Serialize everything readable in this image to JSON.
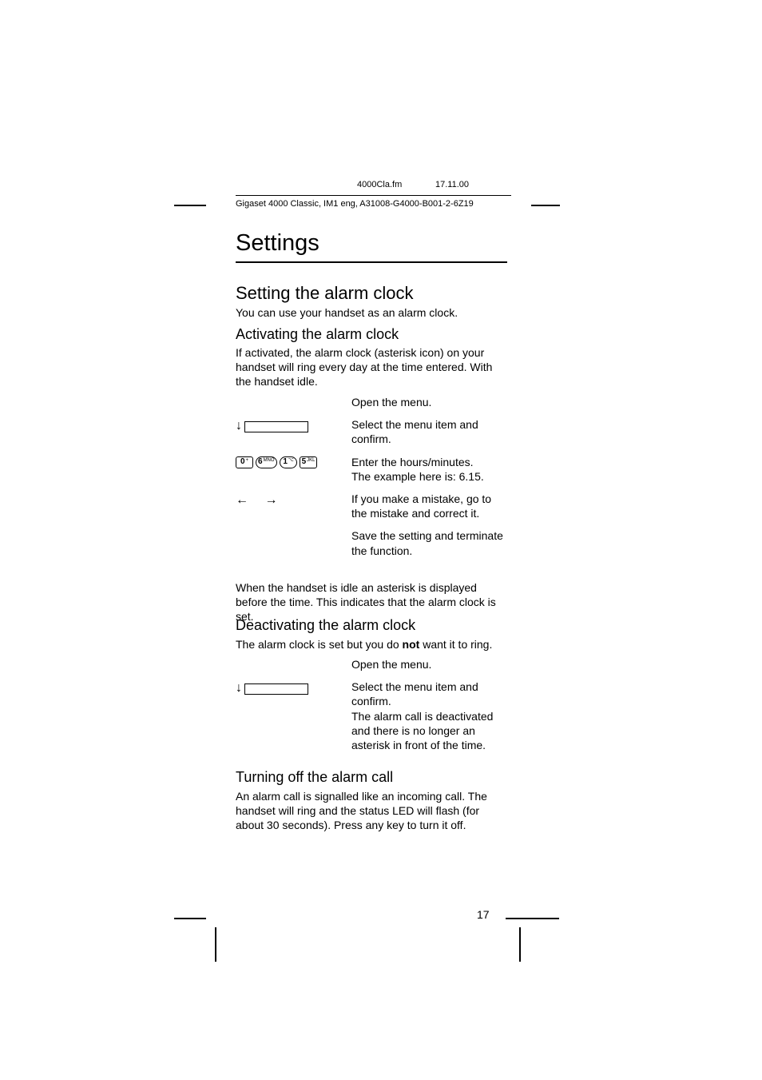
{
  "header": {
    "file": "4000Cla.fm",
    "date": "17.11.00",
    "product_line": "Gigaset 4000 Classic, IM1 eng, A31008-G4000-B001-2-6Z19"
  },
  "title": "Settings",
  "section": {
    "heading": "Setting the alarm clock",
    "intro": "You can use your handset as an alarm clock."
  },
  "activate": {
    "heading": "Activating the alarm clock",
    "intro": "If activated, the alarm clock (asterisk icon) on your handset will ring every day at the time entered. With the handset idle.",
    "steps": {
      "open": "Open the menu.",
      "select": "Select the menu item and confirm.",
      "enter": "Enter the hours/minutes.\nThe example here is: 6.15.",
      "correct": "If you make a mistake, go to the mistake and correct it.",
      "save": "Save the setting and terminate the function."
    },
    "note": "When the handset is idle an asterisk is displayed before the time. This indicates that the alarm clock is set.",
    "keys": {
      "k1": "0",
      "k1s": "+",
      "k2": "6",
      "k2s": "MNO",
      "k3": "1",
      "k3s": "",
      "k4": "5",
      "k4s": "JKL"
    }
  },
  "deactivate": {
    "heading": "Deactivating the alarm clock",
    "intro_pre": "The alarm clock is set but you do ",
    "intro_bold": "not",
    "intro_post": " want it to ring.",
    "steps": {
      "open": "Open the menu.",
      "select": "Select the menu item and confirm.\nThe alarm call is deactivated and there is no longer an asterisk in front of the time."
    }
  },
  "turnoff": {
    "heading": "Turning off the alarm call",
    "body": "An alarm call is signalled like an incoming call. The handset will ring and the status LED will flash (for about 30 seconds). Press any key to turn it off."
  },
  "page_number": "17"
}
